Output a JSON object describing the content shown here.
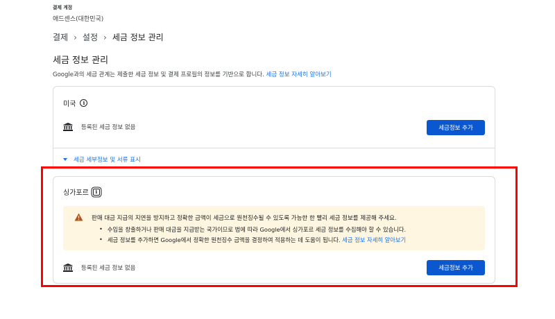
{
  "account": {
    "label": "결제 계정",
    "name": "애드센스(대한민국)"
  },
  "breadcrumb": {
    "items": [
      "결제",
      "설정",
      "세금 정보 관리"
    ]
  },
  "page": {
    "title": "세금 정보 관리",
    "description": "Google과의 세금 관계는 제출한 세금 정보 및 결제 프로필의 정보를 기반으로 합니다.",
    "learn_more": "세금 정보 자세히 알아보기"
  },
  "us_section": {
    "country": "미국",
    "empty_text": "등록된 세금 정보 없음",
    "add_button": "세금정보 추가",
    "details_toggle": "세금 세부정보 및 서류 표시"
  },
  "sg_section": {
    "country": "싱가포르",
    "warning_title": "판매 대금 지급의 지연을 방지하고 정확한 금액이 세금으로 원천징수될 수 있도록 가능한 한 빨리 세금 정보를 제공해 주세요.",
    "bullet_1": "수입을 창출하거나 판매 대금을 지급받는 국가이므로 법에 따라 Google에서 싱가포르 세금 정보를 수집해야 할 수 있습니다.",
    "bullet_2": "세금 정보를 추가하면 Google에서 정확한 원천징수 금액을 결정하여 적용하는 데 도움이 됩니다.",
    "bullet_2_link": "세금 정보 자세히 알아보기",
    "empty_text": "등록된 세금 정보 없음",
    "add_button": "세금정보 추가"
  },
  "icons": {
    "info": "info-icon",
    "bank": "bank-icon",
    "warning": "warning-icon",
    "caret": "caret-down-icon"
  },
  "colors": {
    "primary": "#0b57d0",
    "link": "#1a73e8",
    "warning_bg": "#fef6e0",
    "warning_icon": "#b3541e",
    "highlight": "#ff0000"
  }
}
